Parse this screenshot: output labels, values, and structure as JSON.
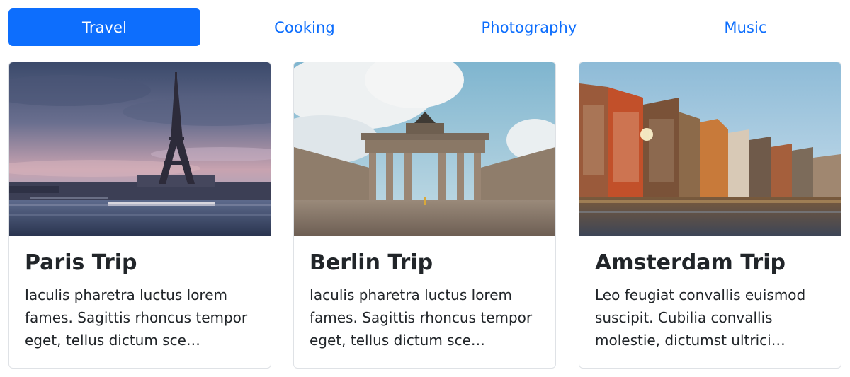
{
  "tabs": [
    {
      "label": "Travel",
      "active": true
    },
    {
      "label": "Cooking",
      "active": false
    },
    {
      "label": "Photography",
      "active": false
    },
    {
      "label": "Music",
      "active": false
    }
  ],
  "colors": {
    "accent": "#0d6efd",
    "border": "#dfe2e6",
    "text": "#212529"
  },
  "cards": [
    {
      "title": "Paris Trip",
      "text": "Iaculis pharetra luctus lorem fames. Sagittis rhoncus tempor eget, tellus dictum sce…",
      "image": "eiffel-tower-photo"
    },
    {
      "title": "Berlin Trip",
      "text": "Iaculis pharetra luctus lorem fames. Sagittis rhoncus tempor eget, tellus dictum sce…",
      "image": "brandenburg-gate-photo"
    },
    {
      "title": "Amsterdam Trip",
      "text": "Leo feugiat convallis euismod suscipit. Cubilia convallis molestie, dictumst ultrici…",
      "image": "amsterdam-canal-houses-photo"
    }
  ]
}
